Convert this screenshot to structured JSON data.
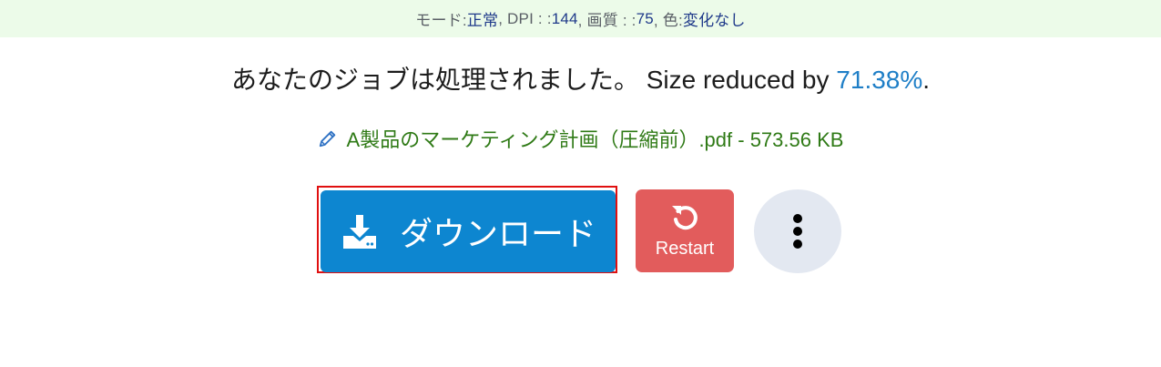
{
  "settings": {
    "mode_label": "モード: ",
    "mode_value": "正常",
    "dpi_label": ", DPI : : ",
    "dpi_value": "144",
    "quality_label": ", 画質 : : ",
    "quality_value": "75",
    "color_label": ", 色: ",
    "color_value": "変化なし"
  },
  "result": {
    "message": "あなたのジョブは処理されました。 Size reduced by ",
    "percent": "71.38%",
    "period": "."
  },
  "file": {
    "name": "A製品のマーケティング計画（圧縮前）.pdf - 573.56 KB"
  },
  "actions": {
    "download_label": "ダウンロード",
    "restart_label": "Restart"
  },
  "icons": {
    "edit": "pencil-icon",
    "download": "download-icon",
    "restart": "restart-icon",
    "more": "more-vertical-icon"
  },
  "colors": {
    "download_bg": "#0d86d0",
    "restart_bg": "#e25c5c",
    "more_bg": "#e3e8f1",
    "settings_bg": "#ecfbe9",
    "percent": "#1f7fc7",
    "file_name": "#2f7a16",
    "highlight": "#e01010"
  }
}
